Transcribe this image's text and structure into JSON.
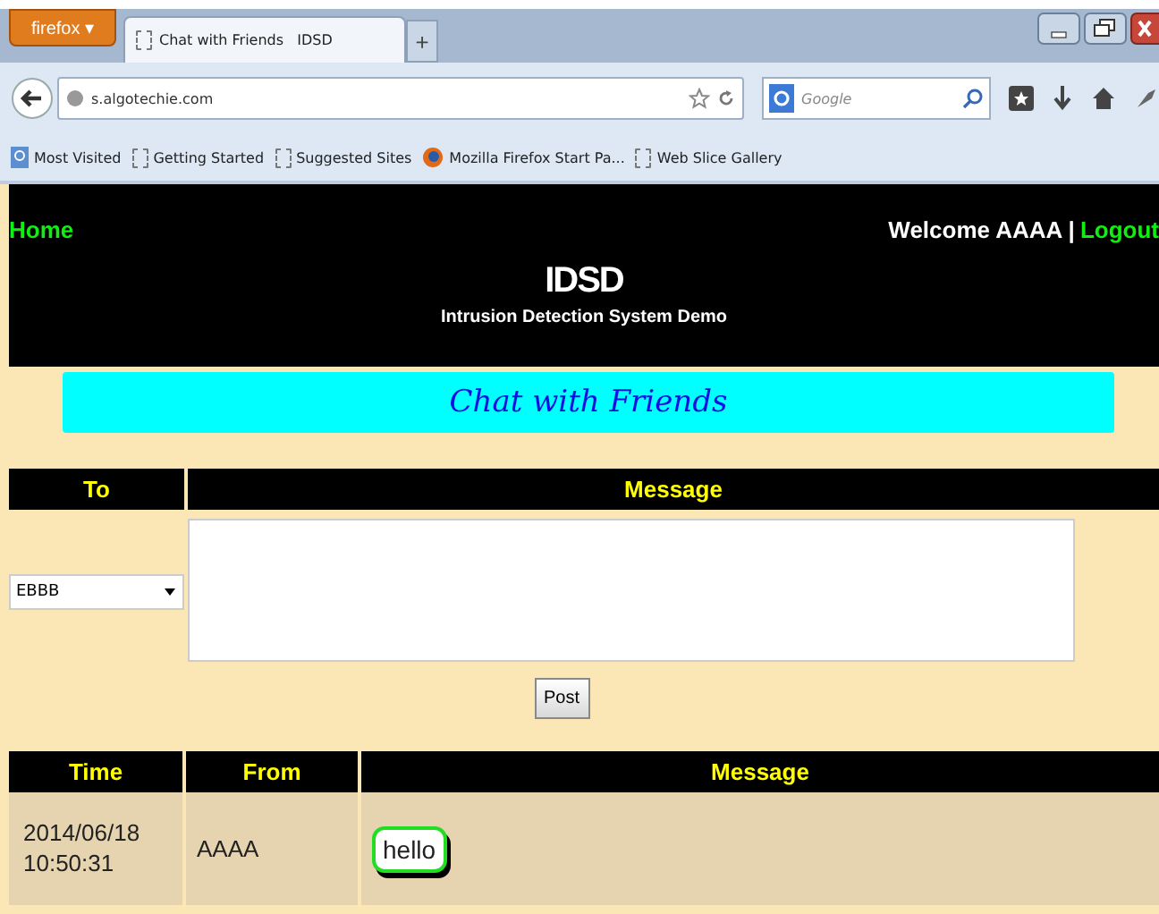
{
  "browser": {
    "menu_button": "firefox ▾",
    "tabs": [
      {
        "title": "Chat with Friends   IDSD",
        "selected": true
      }
    ],
    "new_tab": "+",
    "address": "s.algotechie.com",
    "search_placeholder": "Google",
    "bookmarks": [
      "Most Visited",
      "Getting Started",
      "Suggested Sites",
      "Mozilla Firefox Start Pa...",
      "Web Slice Gallery"
    ]
  },
  "header": {
    "home_link": "Home",
    "welcome": "Welcome AAAA |",
    "logout_link": "Logout",
    "title": "IDSD",
    "subtitle": "Intrusion Detection System Demo"
  },
  "banner": "Chat with Friends",
  "compose": {
    "columns": [
      "To",
      "Message"
    ],
    "recipient": "EBBB",
    "post_button": "Post"
  },
  "messages": {
    "columns": [
      "Time",
      "From",
      "Message"
    ],
    "rows": [
      {
        "time": "2014/06/18 10:50:31",
        "from": "AAAA",
        "message": "hello"
      }
    ]
  }
}
